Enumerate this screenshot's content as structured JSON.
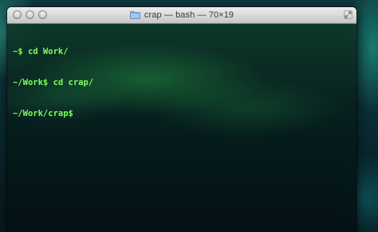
{
  "window": {
    "title": "crap — bash — 70×19",
    "folder_icon": "folder-icon",
    "buttons": [
      "close",
      "minimize",
      "zoom"
    ],
    "resize_icon": "fullscreen-arrows-icon"
  },
  "terminal": {
    "lines": [
      "~$ cd Work/",
      "~/Work$ cd crap/",
      "~/Work/crap$"
    ],
    "text_color": "#7dff5a"
  }
}
